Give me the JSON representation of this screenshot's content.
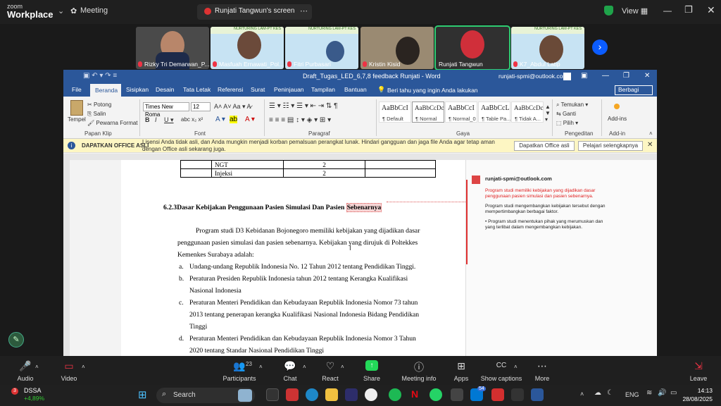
{
  "zoom": {
    "logo_top": "zoom",
    "logo_bottom": "Workplace",
    "meeting_label": "Meeting",
    "share_label": "Runjati Tangwun's screen",
    "view_label": "View",
    "participants": [
      {
        "name": "Rizky Tri Demarwan_P..."
      },
      {
        "name": "Masfuah Ernawati_Pol..."
      },
      {
        "name": "Fitri Purbasari"
      },
      {
        "name": "Kristin Kisid"
      },
      {
        "name": "Runjati Tangwun"
      },
      {
        "name": "K7_Abdul Latip"
      }
    ],
    "banner_text": "NURTURING LAM-PT KES",
    "toolbar": {
      "audio": "Audio",
      "video": "Video",
      "participants": "Participants",
      "participants_count": "23",
      "chat": "Chat",
      "react": "React",
      "share": "Share",
      "meeting_info": "Meeting info",
      "apps": "Apps",
      "show_captions": "Show captions",
      "more": "More",
      "leave": "Leave"
    }
  },
  "word": {
    "title": "Draft_Tugas_LED_6,7,8 feedback Runjati  -  Word",
    "account": "runjati-spmi@outlook.com",
    "tabs": [
      "File",
      "Beranda",
      "Sisipkan",
      "Desain",
      "Tata Letak",
      "Referensi",
      "Surat",
      "Peninjauan",
      "Tampilan",
      "Bantuan"
    ],
    "tell_me": "Beri tahu yang ingin Anda lakukan",
    "share": "Berbagi",
    "ribbon": {
      "paste": "Tempel",
      "cut": "Potong",
      "copy": "Salin",
      "format_painter": "Pewarna Format",
      "font_name": "Times New Roma",
      "font_size": "12",
      "groups": [
        "Papan Klip",
        "Font",
        "Paragraf",
        "Gaya",
        "Pengeditan",
        "Add-in"
      ],
      "styles": [
        {
          "sample": "AaBbCcI",
          "name": "¶ Default"
        },
        {
          "sample": "AaBbCcDc",
          "name": "¶ Normal"
        },
        {
          "sample": "AaBbCcI",
          "name": "¶ Normal_0"
        },
        {
          "sample": "AaBbCcL",
          "name": "¶ Table Pa..."
        },
        {
          "sample": "AaBbCcDc",
          "name": "¶ Tidak A..."
        }
      ],
      "find": "Temukan",
      "replace": "Ganti",
      "select": "Pilih",
      "addins": "Add-ins"
    },
    "notice": {
      "title": "DAPATKAN OFFICE ASLI",
      "text": "Lisensi Anda tidak asli, dan Anda mungkin menjadi korban pemalsuan perangkat lunak. Hindari gangguan dan jaga file Anda agar tetap aman dengan Office asli sekarang juga.",
      "btn1": "Dapatkan Office asli",
      "btn2": "Pelajari selengkapnya"
    },
    "doc": {
      "table_rows": [
        {
          "c1": "NGT",
          "c2": "2"
        },
        {
          "c1": "Injeksi",
          "c2": "2"
        }
      ],
      "heading_num": "6.2.3",
      "heading_text": "Dasar Kebijakan Penggunaan Pasien Simulasi Dan Pasien ",
      "heading_hl": "Sebenarnya",
      "para_lines": [
        "Program studi D3 Kebidanan Bojonegoro  memiliki kebijakan yang dijadikan dasar",
        "penggunaan pasien simulasi dan pasien sebenarnya. Kebijakan yang dirujuk di Poltekkes",
        "Kemenkes Surabaya adalah:"
      ],
      "list": [
        {
          "m": "a.",
          "lines": [
            "Undang-undang Republik Indonesia No. 12 Tahun 2012 tentang Pendidikan Tinggi."
          ]
        },
        {
          "m": "b.",
          "lines": [
            "Peraturan  Presiden  Republik  Indonesia  tahun  2012  tentang  Kerangka  Kualifikasi",
            "Nasional Indonesia"
          ]
        },
        {
          "m": "c.",
          "lines": [
            "Peraturan  Menteri  Pendidikan  dan  Kebudayaan  Republik  Indonesia  Nomor  73  tahun",
            "2013  tentang  penerapan  kerangka  Kualifikasi  Nasional  Indonesia  Bidang  Pendidikan",
            "Tinggi"
          ]
        },
        {
          "m": "d.",
          "lines": [
            "Peraturan  Menteri  Pendidikan  dan  Kebudayaan  Republik  Indonesia  Nomor  3  Tahun",
            "2020 tentang Standar Nasional Pendidikan Tinggi"
          ]
        }
      ]
    },
    "comment": {
      "author": "runjati-spmi@outlook.com",
      "quote": "Program studi memiliki kebijakan yang dijadikan dasar penggunaan pasien simulasi dan pasien sebenarnya.",
      "body1": "Program studi mengembangkan kebijakan tersebut dengan mempertimbangkan berbagai faktor.",
      "body2": "• Program studi menentukan pihak yang merumuskan dan yang terlibat dalam mengembangkan kebijakan."
    }
  },
  "taskbar": {
    "ticker": "DSSA",
    "change": "+4,89%",
    "notif": "3",
    "search": "Search",
    "badge": "54",
    "lang": "ENG",
    "time": "14:13",
    "date": "28/08/2025"
  },
  "colors": {
    "word_blue": "#2b579a",
    "zoom_share_green": "#23d959",
    "comment_red": "#e03030"
  }
}
